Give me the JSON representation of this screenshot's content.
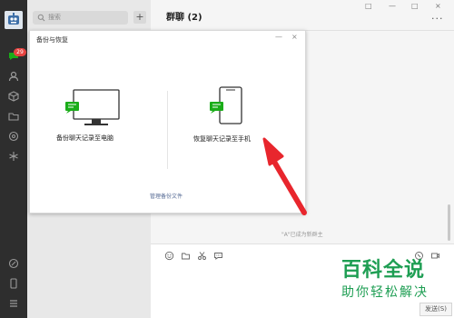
{
  "iconbar": {
    "badge_count": "29"
  },
  "session_list": {
    "search_placeholder": "搜索",
    "add_label": "+"
  },
  "chat": {
    "title": "群聊 (2)",
    "window_controls": [
      "□",
      "—",
      "□",
      "×"
    ],
    "more_label": "···",
    "system_note": "\"A\"已成为新群主",
    "send_label": "发送(S)"
  },
  "dialog": {
    "title": "备份与恢复",
    "minimize_label": "—",
    "close_label": "×",
    "backup_option": "备份聊天记录至电脑",
    "restore_option": "恢复聊天记录至手机",
    "manage_link": "管理备份文件"
  },
  "watermark": {
    "title": "百科全说",
    "subtitle": "助你轻松解决"
  },
  "colors": {
    "sidebar": "#2e2e2e",
    "badge": "#e64340",
    "accent_green": "#1aad19",
    "arrow_red": "#e8262d",
    "watermark_green": "#1e9e53",
    "link": "#576b95"
  }
}
